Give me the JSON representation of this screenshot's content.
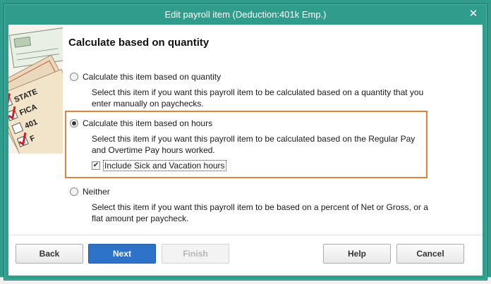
{
  "window": {
    "title": "Edit payroll item (Deduction:401k Emp.)",
    "close_glyph": "✕"
  },
  "illustration": {
    "labels": [
      "STATE",
      "FICA",
      "401",
      "F"
    ]
  },
  "heading": "Calculate based on quantity",
  "options": [
    {
      "label": "Calculate this item based on quantity",
      "selected": false,
      "description": "Select this item if you want this payroll item to be calculated based on a quantity that you enter manually on paychecks."
    },
    {
      "label": "Calculate this item based on hours",
      "selected": true,
      "description": "Select this item if you want this payroll item to be calculated based on the Regular Pay and Overtime Pay hours worked."
    },
    {
      "label": "Neither",
      "selected": false,
      "description": "Select this item if you want this payroll item to be based on a percent of Net or Gross, or a flat amount per paycheck."
    }
  ],
  "checkbox": {
    "label": "Include Sick and Vacation hours",
    "checked": true,
    "glyph": "✔"
  },
  "buttons": {
    "back": "Back",
    "next": "Next",
    "finish": "Finish",
    "help": "Help",
    "cancel": "Cancel"
  },
  "colors": {
    "title_bar": "#2f9c8c",
    "highlight_border": "#e0833a",
    "primary_button": "#2f72c9"
  }
}
